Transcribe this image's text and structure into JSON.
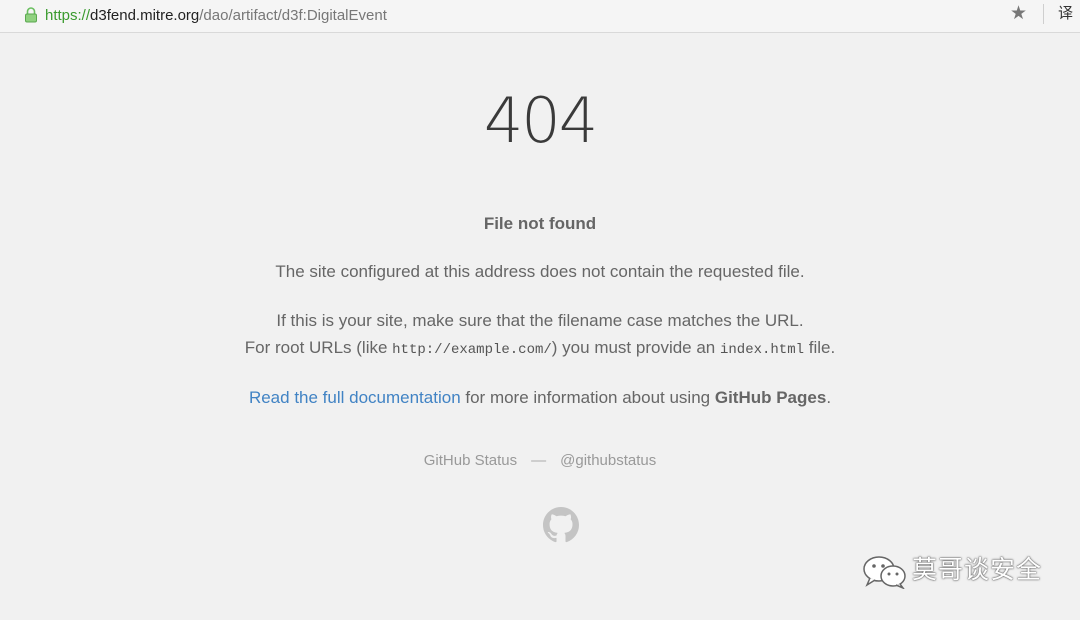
{
  "browser": {
    "url_scheme": "https://",
    "url_host": "d3fend.mitre.org",
    "url_path": "/dao/artifact/d3f:DigitalEvent",
    "icons": {
      "lock": "lock-icon",
      "bookmark": "star-icon",
      "translate": "translate-icon"
    },
    "translate_label": "译"
  },
  "page": {
    "code": "404",
    "title": "File not found",
    "paragraph1": "The site configured at this address does not contain the requested file.",
    "paragraph2_line1": "If this is your site, make sure that the filename case matches the URL.",
    "paragraph2_line2_prefix": "For root URLs (like ",
    "paragraph2_line2_code1": "http://example.com/",
    "paragraph2_line2_mid": ") you must provide an ",
    "paragraph2_line2_code2": "index.html",
    "paragraph2_line2_suffix": " file.",
    "doc_link": "Read the full documentation",
    "doc_text_mid": " for more information about using ",
    "doc_text_bold": "GitHub Pages",
    "doc_text_end": "."
  },
  "footer": {
    "status_link": "GitHub Status",
    "separator": "—",
    "twitter_link": "@githubstatus",
    "logo_icon": "github-octocat-icon"
  },
  "watermark": {
    "icon": "wechat-icon",
    "text": "莫哥谈安全"
  },
  "colors": {
    "link": "#4183c4",
    "url_secure": "#3a9a2e",
    "background": "#f1f1f1"
  }
}
